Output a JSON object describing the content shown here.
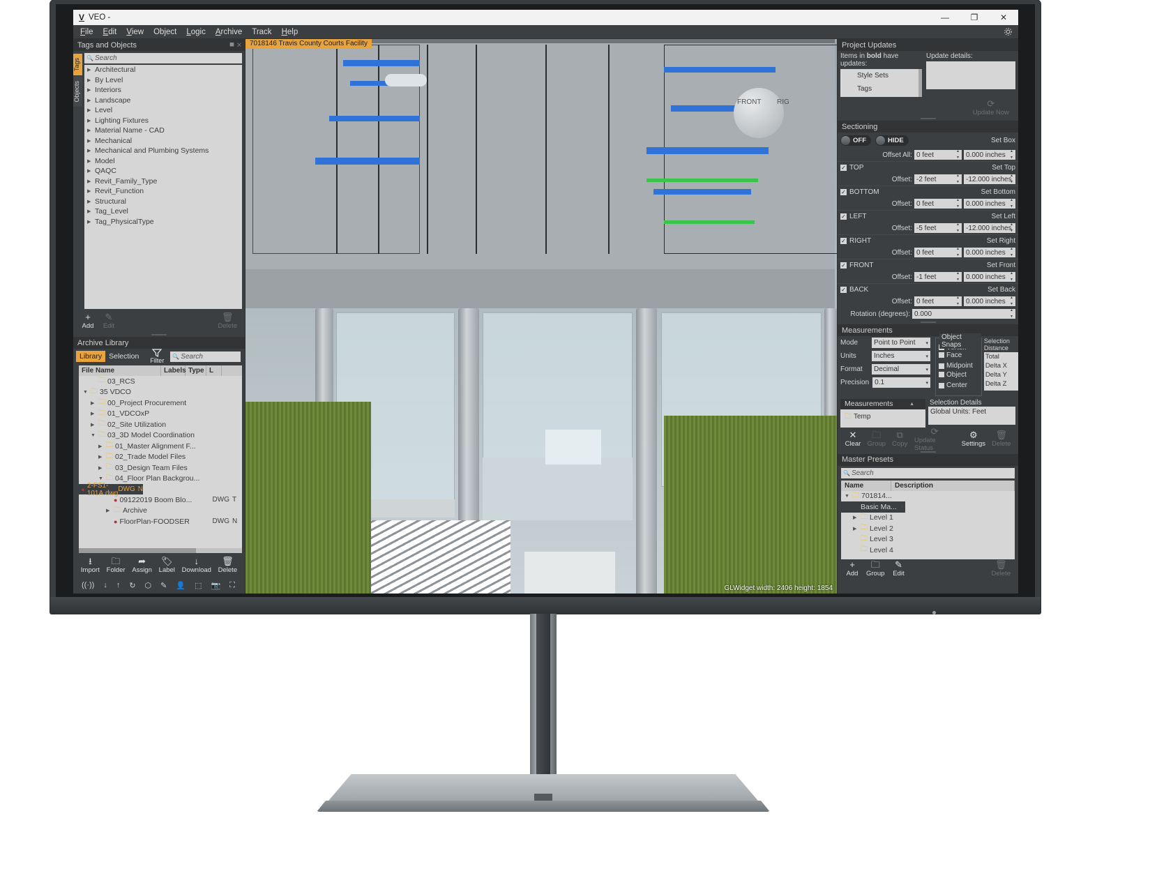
{
  "window": {
    "title": "VEO -",
    "logo": "V",
    "minimize": "—",
    "maximize": "❐",
    "close": "✕"
  },
  "menubar": [
    "File",
    "Edit",
    "View",
    "Object",
    "Logic",
    "Archive",
    "Track",
    "Help"
  ],
  "tags_panel": {
    "title": "Tags and Objects",
    "dock_buttons": "⯀ ✕",
    "vtabs": [
      {
        "label": "Tags",
        "active": true
      },
      {
        "label": "Objects",
        "active": false
      }
    ],
    "search_placeholder": "Search",
    "items": [
      "Architectural",
      "By Level",
      "Interiors",
      "Landscape",
      "Level",
      "Lighting Fixtures",
      "Material Name - CAD",
      "Mechanical",
      "Mechanical and Plumbing Systems",
      "Model",
      "QAQC",
      "Revit_Family_Type",
      "Revit_Function",
      "Structural",
      "Tag_Level",
      "Tag_PhysicalType"
    ],
    "buttons": [
      {
        "icon": "+",
        "label": "Add",
        "disabled": false
      },
      {
        "icon": "✎",
        "label": "Edit",
        "disabled": true
      },
      {
        "icon": "🗑",
        "label": "Delete",
        "disabled": true
      }
    ]
  },
  "archive_panel": {
    "title": "Archive Library",
    "tabs": [
      {
        "label": "Library",
        "active": true
      },
      {
        "label": "Selection",
        "active": false
      }
    ],
    "filter_label": "Filter",
    "search_placeholder": "Search",
    "columns": [
      "File Name",
      "Labels",
      "Type",
      "L"
    ],
    "rows": [
      {
        "indent": 1,
        "arrow": "none",
        "icon": "folder",
        "name": "03_RCS",
        "type": "",
        "l": ""
      },
      {
        "indent": 0,
        "arrow": "open",
        "icon": "folder",
        "name": "35 VDCO",
        "type": "",
        "l": ""
      },
      {
        "indent": 1,
        "arrow": "closed",
        "icon": "folder",
        "name": "00_Project Procurement",
        "type": "",
        "l": ""
      },
      {
        "indent": 1,
        "arrow": "closed",
        "icon": "folder",
        "name": "01_VDCOxP",
        "type": "",
        "l": ""
      },
      {
        "indent": 1,
        "arrow": "closed",
        "icon": "folder",
        "name": "02_Site Utilization",
        "type": "",
        "l": ""
      },
      {
        "indent": 1,
        "arrow": "open",
        "icon": "folder",
        "name": "03_3D Model Coordination",
        "type": "",
        "l": ""
      },
      {
        "indent": 2,
        "arrow": "closed",
        "icon": "folder",
        "name": "01_Master Alignment F...",
        "type": "",
        "l": ""
      },
      {
        "indent": 2,
        "arrow": "closed",
        "icon": "folder",
        "name": "02_Trade Model Files",
        "type": "",
        "l": ""
      },
      {
        "indent": 2,
        "arrow": "closed",
        "icon": "folder",
        "name": "03_Design Team Files",
        "type": "",
        "l": ""
      },
      {
        "indent": 2,
        "arrow": "open",
        "icon": "folder",
        "name": "04_Floor Plan Backgrou...",
        "type": "",
        "l": ""
      },
      {
        "indent": 3,
        "arrow": "none",
        "icon": "dot",
        "name": "2-FS1-101A.dwg",
        "type": "DWG",
        "l": "N",
        "selected": true
      },
      {
        "indent": 3,
        "arrow": "none",
        "icon": "dot",
        "name": "09122019 Boom Blo...",
        "type": "DWG",
        "l": "T"
      },
      {
        "indent": 3,
        "arrow": "closed",
        "icon": "folder",
        "name": "Archive",
        "type": "",
        "l": ""
      },
      {
        "indent": 3,
        "arrow": "none",
        "icon": "dot",
        "name": "FloorPlan-FOODSER",
        "type": "DWG",
        "l": "N"
      }
    ],
    "buttons": [
      {
        "icon": "⭳",
        "label": "Import"
      },
      {
        "icon": "🗀",
        "label": "Folder"
      },
      {
        "icon": "➦",
        "label": "Assign"
      },
      {
        "icon": "🏷",
        "label": "Label"
      },
      {
        "icon": "↓",
        "label": "Download"
      },
      {
        "icon": "🗑",
        "label": "Delete"
      }
    ],
    "status_icons": [
      "((·))",
      "↓",
      "↑",
      "↻",
      "⬡",
      "✎",
      "👤",
      "⬚",
      "📷",
      "⛶"
    ]
  },
  "viewport": {
    "tab_label": "7018146 Travis County Courts Facility",
    "status": "GLWidget  width: 2406    height: 1854",
    "cube_front": "FRONT",
    "cube_right": "RIG"
  },
  "project_updates": {
    "title": "Project Updates",
    "note_prefix": "Items in ",
    "note_bold": "bold",
    "note_suffix": " have updates:",
    "details_label": "Update details:",
    "items": [
      "Style Sets",
      "Tags"
    ],
    "update_now": "Update Now"
  },
  "sectioning": {
    "title": "Sectioning",
    "toggle_off": "OFF",
    "toggle_hide": "HIDE",
    "offset_all_label": "Offset All:",
    "offset_all_feet": "0 feet",
    "offset_all_inches": "0.000 inches",
    "set_box": "Set Box",
    "planes": [
      {
        "name": "TOP",
        "checked": true,
        "set": "Set Top",
        "offset_label": "Offset:",
        "feet": "-2 feet",
        "inches": "-12.000 inches"
      },
      {
        "name": "BOTTOM",
        "checked": true,
        "set": "Set Bottom",
        "offset_label": "Offset:",
        "feet": "0 feet",
        "inches": "0.000 inches"
      },
      {
        "name": "LEFT",
        "checked": true,
        "set": "Set Left",
        "offset_label": "Offset:",
        "feet": "-5 feet",
        "inches": "-12.000 inches"
      },
      {
        "name": "RIGHT",
        "checked": true,
        "set": "Set Right",
        "offset_label": "Offset:",
        "feet": "0 feet",
        "inches": "0.000 inches"
      },
      {
        "name": "FRONT",
        "checked": true,
        "set": "Set Front",
        "offset_label": "Offset:",
        "feet": "-1 feet",
        "inches": "0.000 inches"
      },
      {
        "name": "BACK",
        "checked": true,
        "set": "Set Back",
        "offset_label": "Offset:",
        "feet": "0 feet",
        "inches": "0.000 inches"
      }
    ],
    "rotation_label": "Rotation (degrees):",
    "rotation_value": "0.000"
  },
  "measurements": {
    "title": "Measurements",
    "fields": [
      {
        "label": "Mode",
        "value": "Point to Point"
      },
      {
        "label": "Units",
        "value": "Inches"
      },
      {
        "label": "Format",
        "value": "Decimal"
      },
      {
        "label": "Precision",
        "value": "0.1"
      }
    ],
    "object_snaps": {
      "caption": "Object Snaps",
      "options": [
        {
          "label": "Vertex",
          "checked": true
        },
        {
          "label": "Face",
          "checked": false
        },
        {
          "label": "Midpoint",
          "checked": false
        },
        {
          "label": "Object",
          "checked": false
        },
        {
          "label": "Center",
          "checked": false
        }
      ]
    },
    "selection_distance": {
      "caption": "Selection Distance",
      "rows": [
        "Total",
        "Delta X",
        "Delta Y",
        "Delta Z"
      ]
    },
    "list_title": "Measurements",
    "list_items": [
      "Temp"
    ],
    "selection_details": {
      "caption": "Selection Details",
      "value": "Global Units: Feet"
    },
    "buttons": [
      {
        "icon": "✕",
        "label": "Clear",
        "disabled": false
      },
      {
        "icon": "🗀",
        "label": "Group",
        "disabled": true
      },
      {
        "icon": "⧉",
        "label": "Copy",
        "disabled": true
      },
      {
        "icon": "⟳",
        "label": "Update Status",
        "disabled": true
      },
      {
        "icon": "⚙",
        "label": "Settings",
        "disabled": false
      },
      {
        "icon": "🗑",
        "label": "Delete",
        "disabled": true
      }
    ]
  },
  "master_presets": {
    "title": "Master Presets",
    "search_placeholder": "Search",
    "columns": [
      "Name",
      "Description"
    ],
    "rows": [
      {
        "indent": 0,
        "arrow": "open",
        "icon": "folder",
        "name": "701814...",
        "selected": false
      },
      {
        "indent": 1,
        "arrow": "none",
        "icon": "none",
        "name": "Basic Ma...",
        "selected": true
      },
      {
        "indent": 1,
        "arrow": "closed",
        "icon": "folder",
        "name": "Level 1",
        "selected": false
      },
      {
        "indent": 1,
        "arrow": "closed",
        "icon": "folder",
        "name": "Level 2",
        "selected": false
      },
      {
        "indent": 1,
        "arrow": "none",
        "icon": "folder",
        "name": "Level 3",
        "selected": false
      },
      {
        "indent": 1,
        "arrow": "none",
        "icon": "folder",
        "name": "Level 4",
        "selected": false
      }
    ],
    "buttons": [
      {
        "icon": "+",
        "label": "Add",
        "disabled": false
      },
      {
        "icon": "🗀",
        "label": "Group",
        "disabled": false
      },
      {
        "icon": "✎",
        "label": "Edit",
        "disabled": false
      },
      {
        "icon": "🗑",
        "label": "Delete",
        "disabled": true
      }
    ]
  },
  "colors": {
    "accent": "#e8a33d",
    "panel_bg": "#3c3f41",
    "header_bg": "#313335",
    "field_bg": "#d6d6d6"
  }
}
